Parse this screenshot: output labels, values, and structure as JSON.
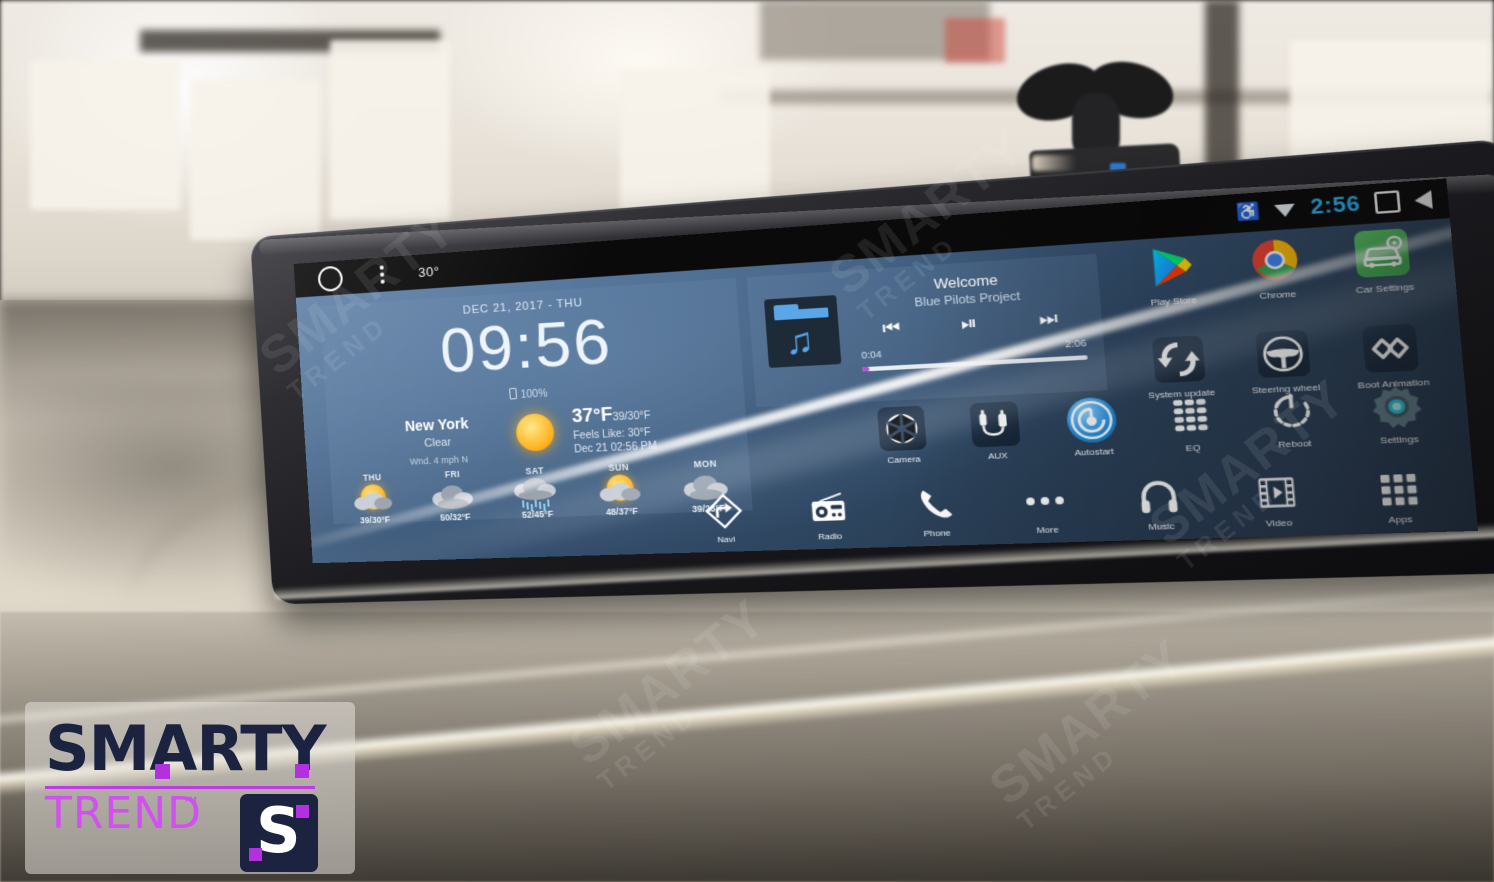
{
  "statusbar": {
    "home_icon": "circle-home-icon",
    "menu_icon": "overflow-menu-icon",
    "temperature": "30°"
  },
  "system_status": {
    "bluetooth_icon": "bluetooth-icon",
    "wifi_icon": "wifi-icon",
    "clock": "2:56",
    "recents_icon": "recents-square-icon",
    "back_icon": "back-triangle-icon"
  },
  "clock_widget": {
    "date": "DEC 21, 2017 - THU",
    "time": "09:56",
    "battery": "100%"
  },
  "weather": {
    "city": "New York",
    "condition": "Clear",
    "wind": "Wnd. 4 mph N",
    "temperature": "37°F",
    "high_low": "39/30°F",
    "feels_like": "Feels Like: 30°F",
    "observed": "Dec 21  02:56 PM",
    "icon": "sun-icon",
    "forecast": [
      {
        "day": "THU",
        "temps": "39/30°F",
        "icon": "sun-cloud-icon"
      },
      {
        "day": "FRI",
        "temps": "50/32°F",
        "icon": "cloud-icon"
      },
      {
        "day": "SAT",
        "temps": "52/45°F",
        "icon": "rain-icon"
      },
      {
        "day": "SUN",
        "temps": "48/37°F",
        "icon": "sun-cloud-icon"
      },
      {
        "day": "MON",
        "temps": "39/28°F",
        "icon": "cloud-icon"
      }
    ]
  },
  "music_widget": {
    "title": "Welcome",
    "artist": "Blue Pilots Project",
    "elapsed": "0:04",
    "duration": "2:06",
    "album_icon": "music-folder-icon",
    "prev_icon": "previous-track-icon",
    "playpause_icon": "play-pause-icon",
    "next_icon": "next-track-icon",
    "progress_percent": 3
  },
  "apps_top_right": [
    {
      "label": "Play Store",
      "icon": "play-store-icon"
    },
    {
      "label": "Chrome",
      "icon": "chrome-icon"
    },
    {
      "label": "Car Settings",
      "icon": "car-settings-icon"
    },
    {
      "label": "System update",
      "icon": "system-update-icon"
    },
    {
      "label": "Steering wheel",
      "icon": "steering-wheel-icon"
    },
    {
      "label": "Boot Animation",
      "icon": "boot-animation-icon"
    }
  ],
  "apps_middle": [
    {
      "label": "Camera",
      "icon": "camera-shutter-icon"
    },
    {
      "label": "AUX",
      "icon": "aux-cable-icon"
    },
    {
      "label": "Autostart",
      "icon": "autostart-icon"
    },
    {
      "label": "EQ",
      "icon": "equalizer-icon"
    },
    {
      "label": "Reboot",
      "icon": "reboot-power-icon"
    },
    {
      "label": "Settings",
      "icon": "settings-gear-icon"
    }
  ],
  "dock": [
    {
      "label": "Navi",
      "icon": "navigation-arrow-icon"
    },
    {
      "label": "Radio",
      "icon": "radio-icon"
    },
    {
      "label": "Phone",
      "icon": "phone-handset-icon"
    },
    {
      "label": "More",
      "icon": "more-dots-icon"
    },
    {
      "label": "Music",
      "icon": "headphones-icon"
    },
    {
      "label": "Video",
      "icon": "video-film-icon"
    },
    {
      "label": "Apps",
      "icon": "apps-grid-icon"
    }
  ],
  "watermark": {
    "line1": "SMARTY",
    "line2": "TREND"
  },
  "logo": {
    "smarty": "SMARTY",
    "trend": "TREND",
    "tm": "™",
    "badge_letter": "S"
  },
  "colors": {
    "accent_purple": "#b42fe0",
    "logo_navy": "#1b2340",
    "status_clock_blue": "#29b6f6",
    "wallpaper_blue": "#35506f"
  }
}
